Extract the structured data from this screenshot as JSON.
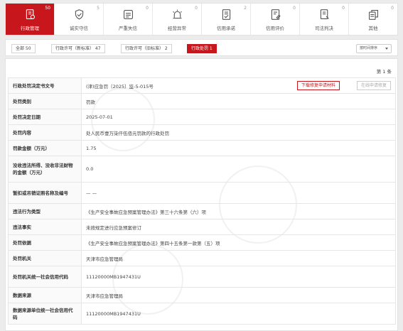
{
  "tabs": [
    {
      "label": "行政管理",
      "count": "50",
      "icon": "document-stamp-icon",
      "active": true
    },
    {
      "label": "诚实守信",
      "count": "5",
      "icon": "shield-hand-icon",
      "active": false
    },
    {
      "label": "严重失信",
      "count": "0",
      "icon": "warning-box-icon",
      "active": false
    },
    {
      "label": "经营异常",
      "count": "0",
      "icon": "alert-lamp-icon",
      "active": false
    },
    {
      "label": "信用承诺",
      "count": "2",
      "icon": "pledge-doc-icon",
      "active": false
    },
    {
      "label": "信用评价",
      "count": "0",
      "icon": "evaluation-doc-icon",
      "active": false
    },
    {
      "label": "司法判决",
      "count": "0",
      "icon": "judgment-doc-icon",
      "active": false
    },
    {
      "label": "其他",
      "count": "0",
      "icon": "other-doc-icon",
      "active": false
    }
  ],
  "filters": {
    "all": "全部 50",
    "license_new": "行政许可（新标准） 47",
    "license_old": "行政许可（旧标准） 2",
    "penalty": "行政处罚 1",
    "sort": "按时间排序"
  },
  "page_label": "第 1 条",
  "buttons": {
    "download": "下载修复申请材料",
    "online": "在线申请修复"
  },
  "rows": [
    {
      "key": "行政处罚决定书文号",
      "value": "(津)应急罚〔2025〕监-5-015号"
    },
    {
      "key": "处罚类别",
      "value": "罚款"
    },
    {
      "key": "处罚决定日期",
      "value": "2025-07-01"
    },
    {
      "key": "处罚内容",
      "value": "处人民币壹万柒仟伍佰元罚款的行政处罚"
    },
    {
      "key": "罚款金额（万元）",
      "value": "1.75"
    },
    {
      "key": "没收违法所得、没收非法财物的金额（万元）",
      "value": "0.0"
    },
    {
      "key": "暂扣或吊销证照名称及编号",
      "value": "— —"
    },
    {
      "key": "违法行为类型",
      "value": "《生产安全事故应急预案管理办法》第三十六条第（六）项"
    },
    {
      "key": "违法事实",
      "value": "未按规定进行应急预案修订"
    },
    {
      "key": "处罚依据",
      "value": "《生产安全事故应急预案管理办法》第四十五条第一款第（五）项"
    },
    {
      "key": "处罚机关",
      "value": "天津市应急管理局"
    },
    {
      "key": "处罚机关统一社会信用代码",
      "value": "11120000MB1947431U"
    },
    {
      "key": "数据来源",
      "value": "天津市应急管理局"
    },
    {
      "key": "数据来源单位统一社会信用代码",
      "value": "11120000MB1947431U"
    }
  ],
  "colors": {
    "accent": "#c8161d"
  }
}
